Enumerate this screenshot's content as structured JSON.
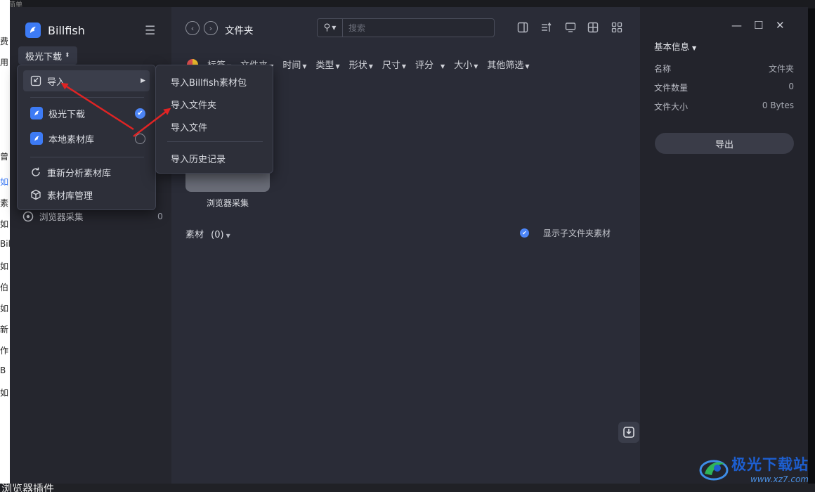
{
  "background": {
    "top_text": "更简单",
    "left_texts": [
      "费",
      "用",
      "曾",
      "如",
      "素",
      "如",
      "Bill",
      "如",
      "伯",
      "如",
      "新",
      "作",
      "B",
      "如"
    ],
    "bottom_text": "浏览器插件"
  },
  "app": {
    "name": "Billfish",
    "library_selector": "极光下载",
    "sidebar_rows": [
      {
        "label": "浏览器采集",
        "count": "0"
      }
    ]
  },
  "library_menu": {
    "import_label": "导入",
    "libraries": [
      {
        "label": "极光下载",
        "selected": true
      },
      {
        "label": "本地素材库",
        "selected": false
      }
    ],
    "reanalyze_label": "重新分析素材库",
    "manage_label": "素材库管理"
  },
  "import_submenu": {
    "items": [
      "导入Billfish素材包",
      "导入文件夹",
      "导入文件"
    ],
    "history_label": "导入历史记录"
  },
  "toolbar": {
    "breadcrumb": "文件夹",
    "search_placeholder": "搜索"
  },
  "filters": [
    "标签",
    "文件夹",
    "时间",
    "类型",
    "形状",
    "尺寸",
    "评分",
    "大小",
    "其他筛选"
  ],
  "content": {
    "folder_name": "浏览器采集",
    "materials_label": "素材",
    "materials_count": "(0)",
    "show_subfolder_label": "显示子文件夹素材",
    "show_subfolder_checked": true
  },
  "inspector": {
    "title": "基本信息",
    "rows": [
      {
        "label": "名称",
        "value": "文件夹"
      },
      {
        "label": "文件数量",
        "value": "0"
      },
      {
        "label": "文件大小",
        "value": "0 Bytes"
      }
    ],
    "export_label": "导出"
  },
  "watermark": {
    "name": "极光下载站",
    "url": "www.xz7.com"
  },
  "colors": {
    "accent": "#4d86f7",
    "annotation_arrow": "#e02424",
    "sidebar_bg": "#25262e",
    "main_bg": "#2a2c37"
  }
}
